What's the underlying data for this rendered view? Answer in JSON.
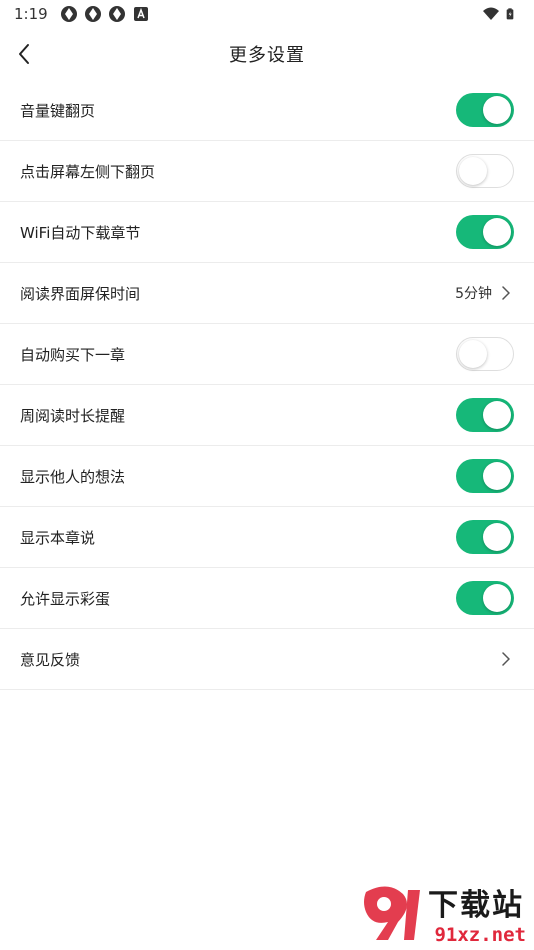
{
  "status_bar": {
    "time": "1:19",
    "icons": [
      "app-icon",
      "app-icon",
      "app-icon",
      "a-icon"
    ],
    "right_icons": [
      "wifi-icon",
      "battery-icon"
    ]
  },
  "nav": {
    "title": "更多设置",
    "back_icon": "chevron-left-icon"
  },
  "settings": [
    {
      "label": "音量键翻页",
      "type": "toggle",
      "on": true
    },
    {
      "label": "点击屏幕左侧下翻页",
      "type": "toggle",
      "on": false
    },
    {
      "label": "WiFi自动下载章节",
      "type": "toggle",
      "on": true
    },
    {
      "label": "阅读界面屏保时间",
      "type": "value",
      "value": "5分钟"
    },
    {
      "label": "自动购买下一章",
      "type": "toggle",
      "on": false
    },
    {
      "label": "周阅读时长提醒",
      "type": "toggle",
      "on": true
    },
    {
      "label": "显示他人的想法",
      "type": "toggle",
      "on": true
    },
    {
      "label": "显示本章说",
      "type": "toggle",
      "on": true
    },
    {
      "label": "允许显示彩蛋",
      "type": "toggle",
      "on": true
    },
    {
      "label": "意见反馈",
      "type": "link"
    }
  ],
  "watermark": {
    "line1": "下载站",
    "line2": "91xz.net"
  },
  "colors": {
    "toggle_on": "#16b879",
    "toggle_off_border": "#dedede",
    "divider": "#ececec"
  }
}
